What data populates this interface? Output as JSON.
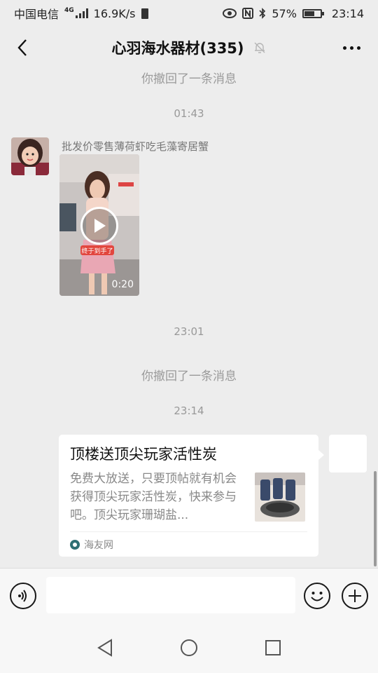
{
  "status_bar": {
    "carrier": "中国电信",
    "network": "4G",
    "speed": "16.9K/s",
    "battery": "57%",
    "time": "23:14"
  },
  "header": {
    "title": "心羽海水器材(335)"
  },
  "messages": {
    "recall_1": "你撤回了一条消息",
    "time_1": "01:43",
    "sender_name": "批发价零售薄荷虾吃毛藻寄居蟹",
    "video_sticker": "终于到手了",
    "video_duration": "0:20",
    "time_2": "23:01",
    "recall_2": "你撤回了一条消息",
    "time_3": "23:14"
  },
  "link_card": {
    "title": "顶楼送顶尖玩家活性炭",
    "description": "免费大放送，只要顶帖就有机会获得顶尖玩家活性炭，快来参与吧。顶尖玩家珊瑚盐...",
    "source": "海友网"
  },
  "input": {
    "value": ""
  },
  "colors": {
    "background": "#ededed",
    "bubble": "#ffffff",
    "source_icon": "#2f6f73"
  },
  "icons": {
    "back": "chevron-left-icon",
    "mute": "bell-off-icon",
    "more": "more-dots-icon",
    "voice": "voice-icon",
    "emoji": "smiley-icon",
    "plus": "plus-circle-icon"
  }
}
